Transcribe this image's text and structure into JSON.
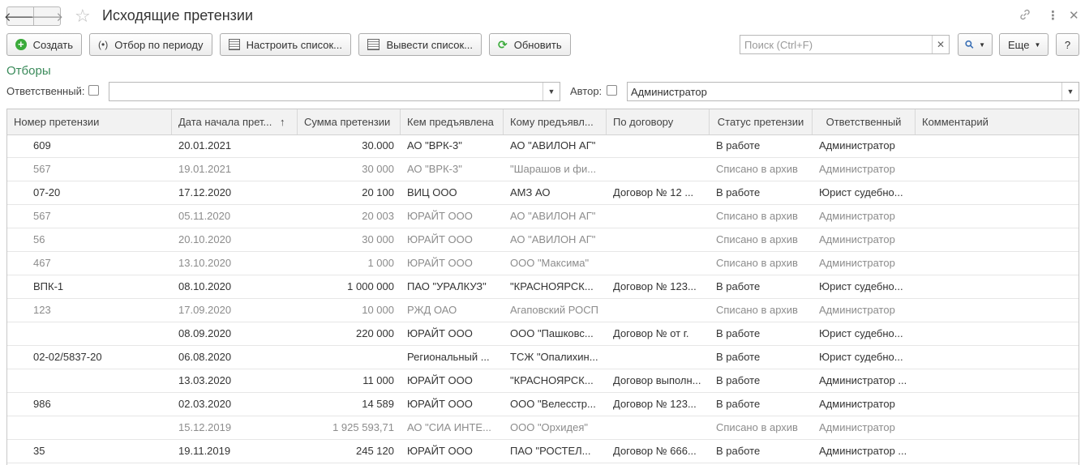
{
  "window": {
    "title": "Исходящие претензии",
    "back_icon": "arrow-left",
    "forward_icon": "arrow-right",
    "favorite_icon": "star",
    "link_icon": "link",
    "more_icon": "kebab",
    "close_icon": "close"
  },
  "toolbar": {
    "create_label": "Создать",
    "period_filter_label": "Отбор по периоду",
    "customize_list_label": "Настроить список...",
    "output_list_label": "Вывести список...",
    "refresh_label": "Обновить",
    "search_placeholder": "Поиск (Ctrl+F)",
    "more_label": "Еще",
    "help_label": "?"
  },
  "filters": {
    "section_label": "Отборы",
    "responsible_label": "Ответственный:",
    "responsible_value": "",
    "author_label": "Автор:",
    "author_value": "Администратор"
  },
  "table": {
    "columns": [
      "Номер претензии",
      "Дата начала прет...",
      "Сумма претензии",
      "Кем предъявлена",
      "Кому предъявл...",
      "По договору",
      "Статус претензии",
      "Ответственный",
      "Комментарий"
    ],
    "sort_indicator": "↑",
    "rows": [
      {
        "status_kind": "active",
        "cells": [
          "609",
          "20.01.2021",
          "30.000",
          "АО \"ВРК-3\"",
          "АО \"АВИЛОН АГ\"",
          "",
          "В работе",
          "Администратор",
          ""
        ]
      },
      {
        "status_kind": "archived",
        "cells": [
          "567",
          "19.01.2021",
          "30 000",
          "АО \"ВРК-3\"",
          "\"Шарашов и фи...",
          "",
          "Списано в архив",
          "Администратор",
          ""
        ]
      },
      {
        "status_kind": "active",
        "cells": [
          "07-20",
          "17.12.2020",
          "20 100",
          "ВИЦ ООО",
          "АМЗ АО",
          "Договор  № 12 ...",
          "В работе",
          "Юрист судебно...",
          ""
        ]
      },
      {
        "status_kind": "archived",
        "cells": [
          "567",
          "05.11.2020",
          "20 003",
          "ЮРАЙТ ООО",
          "АО \"АВИЛОН АГ\"",
          "",
          "Списано в архив",
          "Администратор",
          ""
        ]
      },
      {
        "status_kind": "archived",
        "cells": [
          "56",
          "20.10.2020",
          "30 000",
          "ЮРАЙТ ООО",
          "АО \"АВИЛОН АГ\"",
          "",
          "Списано в архив",
          "Администратор",
          ""
        ]
      },
      {
        "status_kind": "archived",
        "cells": [
          "467",
          "13.10.2020",
          "1 000",
          "ЮРАЙТ ООО",
          "ООО \"Максима\"",
          "",
          "Списано в архив",
          "Администратор",
          ""
        ]
      },
      {
        "status_kind": "active",
        "cells": [
          "ВПК-1",
          "08.10.2020",
          "1 000 000",
          "ПАО \"УРАЛКУЗ\"",
          "\"КРАСНОЯРСК...",
          "Договор  № 123...",
          "В работе",
          "Юрист судебно...",
          ""
        ]
      },
      {
        "status_kind": "archived",
        "cells": [
          "123",
          "17.09.2020",
          "10 000",
          "РЖД ОАО",
          "Агаповский РОСП",
          "",
          "Списано в архив",
          "Администратор",
          ""
        ]
      },
      {
        "status_kind": "active",
        "cells": [
          "",
          "08.09.2020",
          "220 000",
          "ЮРАЙТ ООО",
          "ООО \"Пашковс...",
          "Договор  №  от  г.",
          "В работе",
          "Юрист судебно...",
          ""
        ]
      },
      {
        "status_kind": "active",
        "cells": [
          "02-02/5837-20",
          "06.08.2020",
          "",
          "Региональный ...",
          "ТСЖ \"Опалихин...",
          "",
          "В работе",
          "Юрист судебно...",
          ""
        ]
      },
      {
        "status_kind": "active",
        "cells": [
          "",
          "13.03.2020",
          "11 000",
          "ЮРАЙТ ООО",
          "\"КРАСНОЯРСК...",
          "Договор выполн...",
          "В работе",
          "Администратор ...",
          ""
        ]
      },
      {
        "status_kind": "active",
        "cells": [
          "986",
          "02.03.2020",
          "14 589",
          "ЮРАЙТ ООО",
          "ООО \"Велесстр...",
          "Договор  № 123...",
          "В работе",
          "Администратор",
          ""
        ]
      },
      {
        "status_kind": "archived",
        "cells": [
          "",
          "15.12.2019",
          "1 925 593,71",
          "АО \"СИА ИНТЕ...",
          "ООО \"Орхидея\"",
          "",
          "Списано в архив",
          "Администратор",
          ""
        ]
      },
      {
        "status_kind": "active",
        "cells": [
          "35",
          "19.11.2019",
          "245 120",
          "ЮРАЙТ ООО",
          "ПАО \"РОСТЕЛ...",
          "Договор  № 666...",
          "В работе",
          "Администратор ...",
          ""
        ]
      }
    ]
  }
}
